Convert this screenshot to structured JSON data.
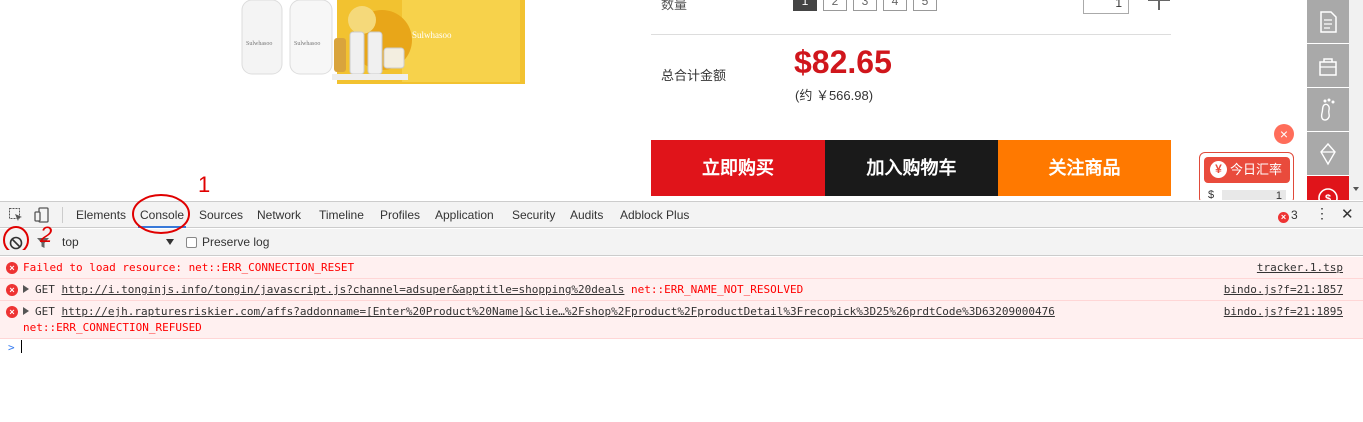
{
  "product": {
    "quantity_label": "数量",
    "quantity_options": [
      "1",
      "2",
      "3",
      "4",
      "5"
    ],
    "quantity_value": "1",
    "total_label": "总合计金额",
    "total_price": "$82.65",
    "total_cny": "(约 ￥566.98)",
    "buy_now_label": "立即购买",
    "add_to_cart_label": "加入购物车",
    "follow_label": "关注商品",
    "brand_text": "Sulwhasoo",
    "colors": {
      "price": "#d0161c",
      "buy": "#e0141a",
      "cart": "#1a1a1a",
      "follow": "#ff7900"
    }
  },
  "rate_widget": {
    "button_label": "今日汇率",
    "currency_symbol": "$",
    "input_value": "1",
    "close_icon": "close-icon"
  },
  "sidebar": {
    "items": [
      "document-icon",
      "bag-icon",
      "footprint-icon",
      "coupon-icon",
      "exchange-icon"
    ]
  },
  "devtools": {
    "tabs": [
      "Elements",
      "Console",
      "Sources",
      "Network",
      "Timeline",
      "Profiles",
      "Application",
      "Security",
      "Audits",
      "Adblock Plus"
    ],
    "active_tab": "Console",
    "error_count": "3",
    "context": "top",
    "preserve_log_label": "Preserve log",
    "messages": [
      {
        "text": "Failed to load resource: net::ERR_CONNECTION_RESET",
        "source": "tracker.1.tsp"
      },
      {
        "verb": "GET",
        "url": "http://i.tonginjs.info/tongin/javascript.js?channel=adsuper&apptitle=shopping%20deals",
        "error": "net::ERR_NAME_NOT_RESOLVED",
        "source": "bindo.js?f=21:1857"
      },
      {
        "verb": "GET",
        "url": "http://ejh.rapturesriskier.com/affs?addonname=[Enter%20Product%20Name]&clie…%2Fshop%2Fproduct%2FproductDetail%3Frecopick%3D25%26prdtCode%3D63209000476",
        "error": "net::ERR_CONNECTION_REFUSED",
        "source": "bindo.js?f=21:1895"
      }
    ],
    "prompt_symbol": ">"
  },
  "annotations": {
    "label_1": "1",
    "label_2": "2",
    "color": "#e00000"
  }
}
